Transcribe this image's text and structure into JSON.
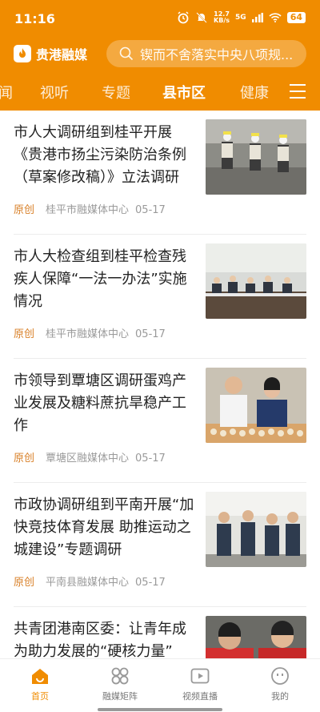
{
  "status": {
    "time": "11:16",
    "net_speed_top": "12.7",
    "net_speed_bottom": "KB/s",
    "network": "5G",
    "battery": "64"
  },
  "brand": {
    "name": "贵港融媒"
  },
  "search": {
    "placeholder": "锲而不舍落实中央八项规..."
  },
  "tabs": [
    "闻",
    "视听",
    "专题",
    "县市区",
    "健康"
  ],
  "active_tab": "县市区",
  "articles": [
    {
      "title": "市人大调研组到桂平开展《贵港市扬尘污染防治条例（草案修改稿）》立法调研",
      "tag": "原创",
      "source": "桂平市融媒体中心",
      "date": "05-17"
    },
    {
      "title": "市人大检查组到桂平检查残疾人保障“一法一办法”实施情况",
      "tag": "原创",
      "source": "桂平市融媒体中心",
      "date": "05-17"
    },
    {
      "title": "市领导到覃塘区调研蛋鸡产业发展及糖料蔗抗旱稳产工作",
      "tag": "原创",
      "source": "覃塘区融媒体中心",
      "date": "05-17"
    },
    {
      "title": "市政协调研组到平南开展“加快竞技体育发展 助推运动之城建设”专题调研",
      "tag": "原创",
      "source": "平南县融媒体中心",
      "date": "05-17"
    },
    {
      "title": "共青团港南区委：让青年成为助力发展的“硬核力量”",
      "tag": "",
      "source": "",
      "date": ""
    }
  ],
  "bottom_nav": [
    {
      "label": "首页",
      "icon": "home-icon",
      "active": true
    },
    {
      "label": "融媒矩阵",
      "icon": "grid-icon",
      "active": false
    },
    {
      "label": "视频直播",
      "icon": "video-icon",
      "active": false
    },
    {
      "label": "我的",
      "icon": "profile-icon",
      "active": false
    }
  ],
  "colors": {
    "primary": "#f08c00",
    "tag": "#d9822b",
    "meta": "#9a9a9a"
  }
}
